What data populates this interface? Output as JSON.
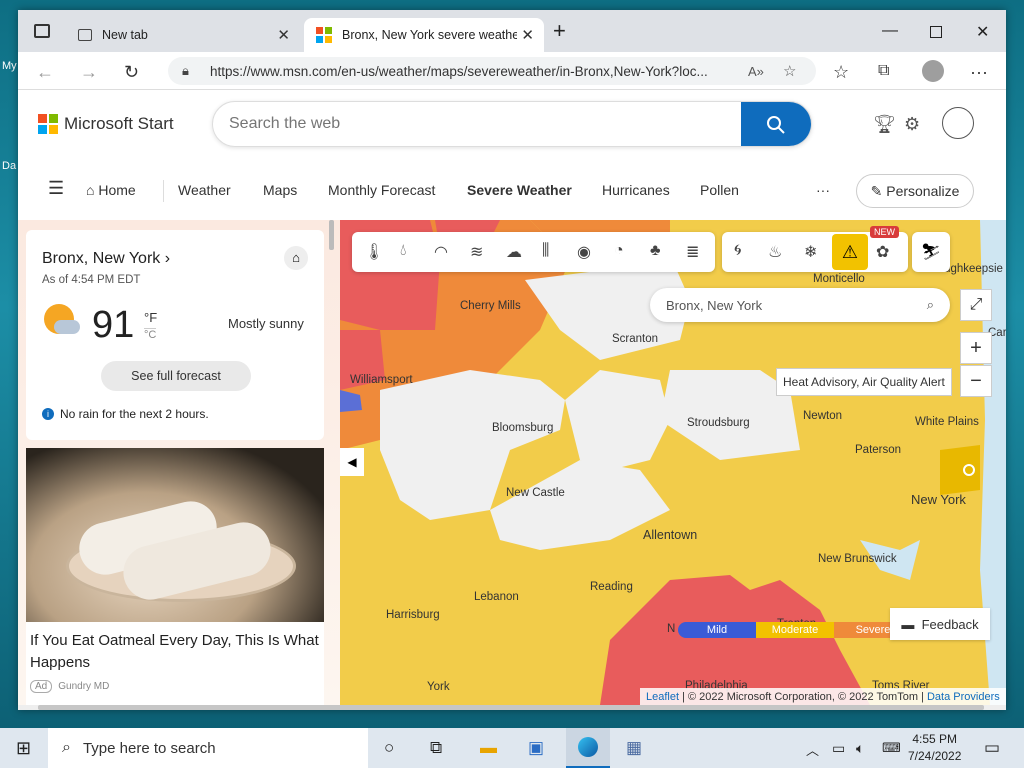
{
  "desktop": {
    "label1": "My",
    "label2": "Da"
  },
  "browser": {
    "tabs": [
      {
        "label": "New tab"
      },
      {
        "label": "Bronx, New York severe weather"
      }
    ],
    "url": "https://www.msn.com/en-us/weather/maps/severeweather/in-Bronx,New-York?loc..."
  },
  "header": {
    "logo_text": "Microsoft Start",
    "search_placeholder": "Search the web"
  },
  "nav": {
    "items": [
      "Home",
      "Weather",
      "Maps",
      "Monthly Forecast",
      "Severe Weather",
      "Hurricanes",
      "Pollen"
    ],
    "active": "Severe Weather",
    "more": "···",
    "personalize": "Personalize"
  },
  "weather_card": {
    "location": "Bronx, New York",
    "time": "As of 4:54 PM EDT",
    "temp": "91",
    "unit_f": "°F",
    "unit_c": "°C",
    "condition": "Mostly sunny",
    "forecast_button": "See full forecast",
    "note": "No rain for the next 2 hours."
  },
  "ad": {
    "headline": "If You Eat Oatmeal Every Day, This Is What Happens",
    "badge": "Ad",
    "source": "Gundry MD"
  },
  "map": {
    "search_value": "Bronx, New York",
    "tooltip": "Heat Advisory, Air Quality Alert",
    "new_badge": "NEW",
    "places": [
      "Cherry Mills",
      "Scranton",
      "Monticello",
      "Poughkeepsie",
      "Williamsport",
      "Bloomsburg",
      "Stroudsburg",
      "Newton",
      "White Plains",
      "Paterson",
      "New York",
      "New Castle",
      "Allentown",
      "New Brunswick",
      "Lebanon",
      "Reading",
      "Harrisburg",
      "Trenton",
      "York",
      "Philadelphia",
      "Toms River",
      "Carm",
      "N"
    ],
    "legend": [
      "Mild",
      "Moderate",
      "Severe"
    ],
    "feedback": "Feedback",
    "attribution": {
      "leaflet": "Leaflet",
      "text": " | © 2022 Microsoft Corporation, © 2022 TomTom | ",
      "providers": "Data Providers"
    },
    "colors": {
      "mild": "#3a5bd6",
      "moderate": "#f2c200",
      "severe": "#ef8a3a",
      "extreme": "#e85c5c"
    }
  },
  "taskbar": {
    "search_placeholder": "Type here to search",
    "time": "4:55 PM",
    "date": "7/24/2022"
  }
}
